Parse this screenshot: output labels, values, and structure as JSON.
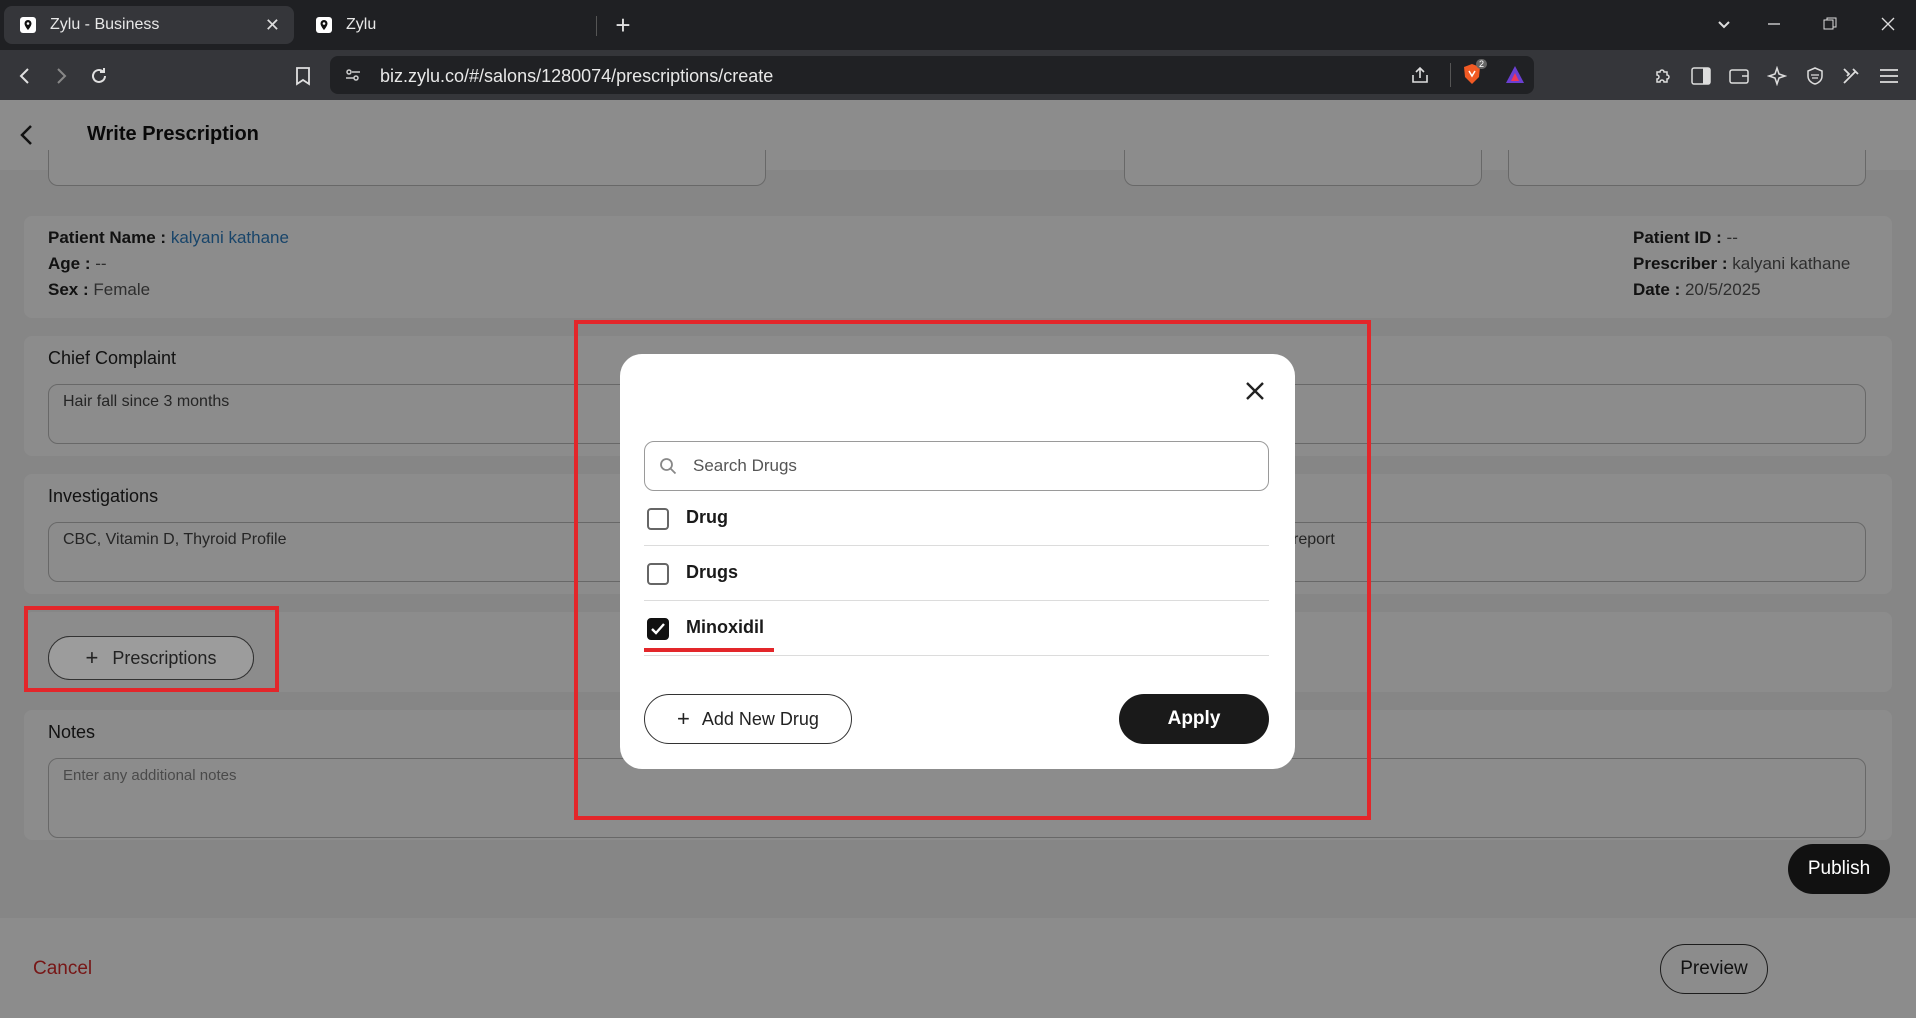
{
  "browser": {
    "tabs": [
      {
        "title": "Zylu - Business",
        "active": true
      },
      {
        "title": "Zylu",
        "active": false
      }
    ],
    "url": "biz.zylu.co/#/salons/1280074/prescriptions/create",
    "shield_count": "2"
  },
  "page": {
    "title": "Write Prescription",
    "patient": {
      "name_label": "Patient Name :",
      "name_value": "kalyani kathane",
      "age_label": "Age :",
      "age_value": "--",
      "sex_label": "Sex :",
      "sex_value": "Female",
      "id_label": "Patient ID :",
      "id_value": "--",
      "prescriber_label": "Prescriber :",
      "prescriber_value": "kalyani kathane",
      "date_label": "Date :",
      "date_value": "20/5/2025"
    },
    "chief_complaint": {
      "label": "Chief Complaint",
      "value": "Hair fall since 3 months"
    },
    "investigations": {
      "label": "Investigations",
      "value": "CBC, Vitamin D, Thyroid Profile",
      "right_value_partial": "report"
    },
    "prescriptions_button": "Prescriptions",
    "notes": {
      "label": "Notes",
      "placeholder": "Enter any additional notes"
    },
    "footer": {
      "cancel": "Cancel",
      "preview": "Preview",
      "publish": "Publish"
    }
  },
  "modal": {
    "search_placeholder": "Search Drugs",
    "drugs": [
      {
        "name": "Drug",
        "checked": false
      },
      {
        "name": "Drugs",
        "checked": false
      },
      {
        "name": "Minoxidil",
        "checked": true
      }
    ],
    "add_new_drug": "Add New Drug",
    "apply": "Apply"
  },
  "colors": {
    "accent_red": "#e3262a",
    "link_blue": "#2f7fc1",
    "primary_dark": "#1a1a1a",
    "cancel_red": "#d92b2b"
  }
}
